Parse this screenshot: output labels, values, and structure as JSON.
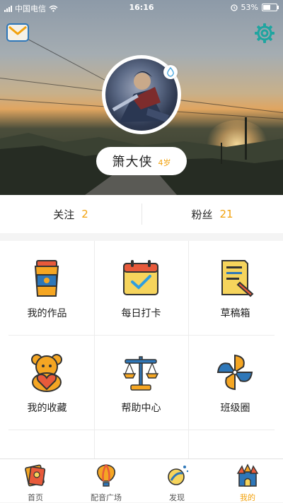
{
  "status_bar": {
    "carrier": "中国电信",
    "time": "16:16",
    "battery": "53%",
    "battery_level": 0.53
  },
  "profile": {
    "name": "箫大侠",
    "age": "4岁"
  },
  "stats": {
    "follow_label": "关注",
    "follow_count": "2",
    "fans_label": "粉丝",
    "fans_count": "21"
  },
  "grid": {
    "items": [
      {
        "label": "我的作品",
        "icon": "cup-icon"
      },
      {
        "label": "每日打卡",
        "icon": "calendar-check-icon"
      },
      {
        "label": "草稿箱",
        "icon": "draft-document-icon"
      },
      {
        "label": "我的收藏",
        "icon": "teddy-bear-heart-icon"
      },
      {
        "label": "帮助中心",
        "icon": "balance-scale-icon"
      },
      {
        "label": "班级圈",
        "icon": "pinwheel-icon"
      }
    ]
  },
  "tabbar": {
    "items": [
      {
        "label": "首页",
        "icon": "book-home-icon"
      },
      {
        "label": "配音广场",
        "icon": "hot-air-balloon-icon"
      },
      {
        "label": "发现",
        "icon": "planet-discover-icon"
      },
      {
        "label": "我的",
        "icon": "castle-profile-icon"
      }
    ],
    "active_index": 3
  },
  "colors": {
    "accent": "#f2a20e",
    "mail_blue": "#2e77b9",
    "settings_teal": "#1fa5a0"
  }
}
